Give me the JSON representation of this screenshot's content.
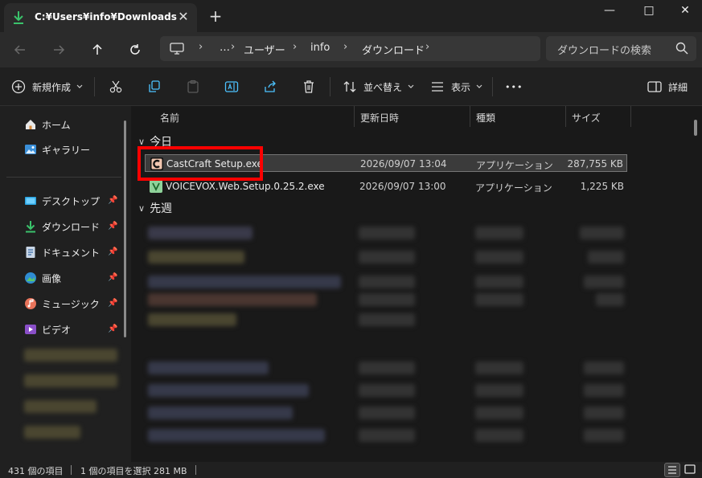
{
  "window": {
    "tab_title": "C:¥Users¥info¥Downloads",
    "tab_close": "✕",
    "new_tab": "+",
    "minimize": "—",
    "maximize": "□",
    "close": "✕"
  },
  "address": {
    "crumbs": [
      "…",
      "ユーザー",
      "info",
      "ダウンロード"
    ],
    "separator": "›",
    "search_placeholder": "ダウンロードの検索"
  },
  "toolbar": {
    "new_label": "新規作成",
    "sort_label": "並べ替え",
    "view_label": "表示",
    "more_label": "•••",
    "details_label": "詳細"
  },
  "sidebar": {
    "items": [
      {
        "label": "ホーム",
        "icon": "home-icon"
      },
      {
        "label": "ギャラリー",
        "icon": "gallery-icon"
      }
    ],
    "pinned": [
      {
        "label": "デスクトップ",
        "icon": "desktop-icon"
      },
      {
        "label": "ダウンロード",
        "icon": "download-icon"
      },
      {
        "label": "ドキュメント",
        "icon": "document-icon"
      },
      {
        "label": "画像",
        "icon": "pictures-icon"
      },
      {
        "label": "ミュージック",
        "icon": "music-icon"
      },
      {
        "label": "ビデオ",
        "icon": "video-icon"
      }
    ],
    "pin_glyph": "📌"
  },
  "columns": {
    "name": "名前",
    "date": "更新日時",
    "type": "種類",
    "size": "サイズ"
  },
  "groups": {
    "today": "今日",
    "last_week": "先週"
  },
  "files": [
    {
      "name": "CastCraft Setup.exe",
      "date": "2026/09/07 13:04",
      "type": "アプリケーション",
      "size": "287,755 KB",
      "selected": true
    },
    {
      "name": "VOICEVOX.Web.Setup.0.25.2.exe",
      "date": "2026/09/07 13:00",
      "type": "アプリケーション",
      "size": "1,225 KB",
      "selected": false
    }
  ],
  "status": {
    "item_count": "431 個の項目",
    "selection": "1 個の項目を選択  281 MB"
  },
  "colors": {
    "accent_highlight": "#ff0000",
    "download_green": "#3ac26b"
  }
}
